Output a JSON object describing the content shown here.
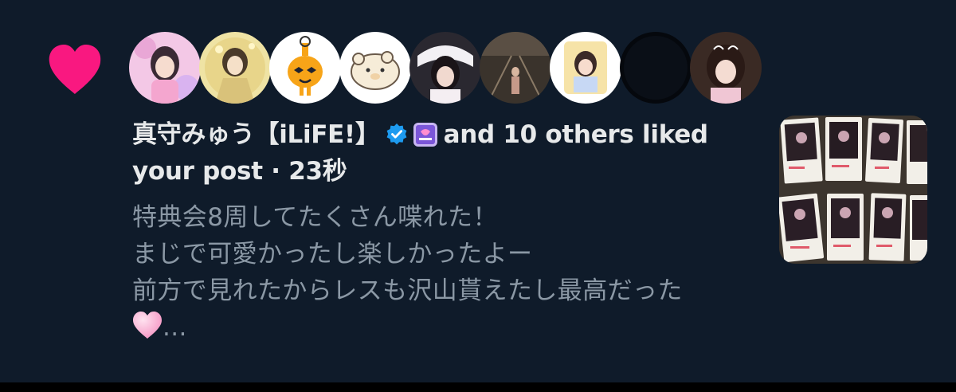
{
  "notification": {
    "type_icon": "heart-icon",
    "accent_color": "#f91880",
    "avatars": [
      {
        "name": "avatar-1"
      },
      {
        "name": "avatar-2"
      },
      {
        "name": "avatar-3"
      },
      {
        "name": "avatar-4"
      },
      {
        "name": "avatar-5"
      },
      {
        "name": "avatar-6"
      },
      {
        "name": "avatar-7"
      },
      {
        "name": "avatar-8"
      },
      {
        "name": "avatar-9"
      }
    ],
    "actor_name": "真守みゅう【iLiFE!】",
    "verified_icon": "verified-badge-icon",
    "affiliate_icon": "affiliate-badge-icon",
    "action_text": "and 10 others liked",
    "action_text_2": "your post",
    "separator": "·",
    "timestamp": "23秒",
    "post_lines": [
      "特典会8周してたくさん喋れた！",
      "まじで可愛かったし楽しかったよー",
      "前方で見れたからレスも沢山貰えたし最高だった"
    ],
    "post_trailing_emoji": "pink-heart-emoji",
    "ellipsis": "...",
    "media_thumbnail": "photo-thumbnail"
  }
}
